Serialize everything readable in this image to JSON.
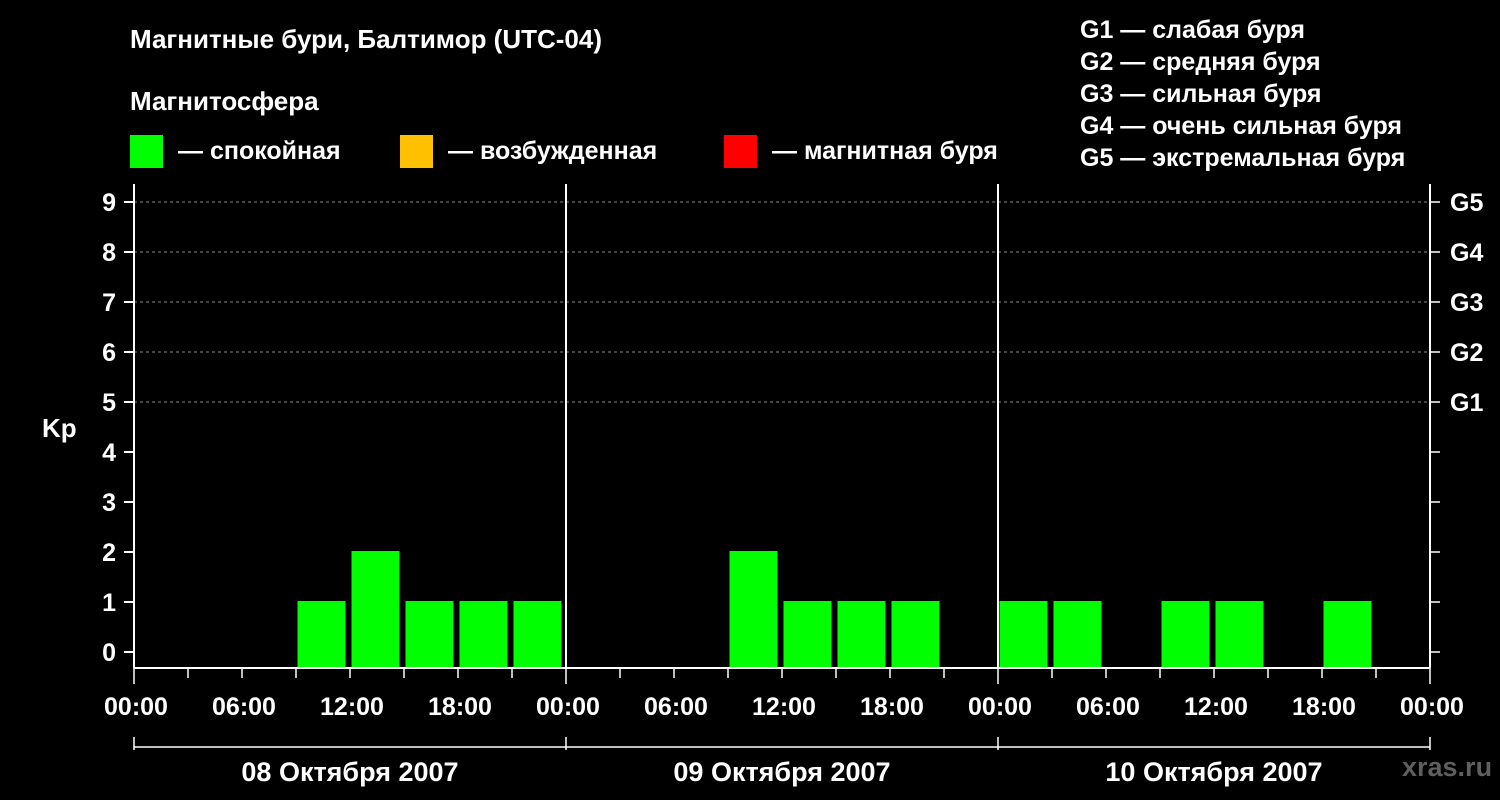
{
  "header": {
    "title": "Магнитные бури, Балтимор (UTC-04)",
    "subtitle": "Магнитосфера"
  },
  "legend": [
    {
      "label": "— спокойная",
      "color": "#00ff00"
    },
    {
      "label": "— возбужденная",
      "color": "#ffc000"
    },
    {
      "label": "— магнитная буря",
      "color": "#ff0000"
    }
  ],
  "storm_scale": [
    "G1 — слабая буря",
    "G2 — средняя буря",
    "G3 — сильная буря",
    "G4 — очень сильная буря",
    "G5 — экстремальная буря"
  ],
  "watermark": "xras.ru",
  "chart_data": {
    "type": "bar",
    "ylabel": "Kp",
    "ylim": [
      0,
      9
    ],
    "yticks": [
      "0",
      "1",
      "2",
      "3",
      "4",
      "5",
      "6",
      "7",
      "8",
      "9"
    ],
    "right_ticks": [
      {
        "kp": 5,
        "label": "G1"
      },
      {
        "kp": 6,
        "label": "G2"
      },
      {
        "kp": 7,
        "label": "G3"
      },
      {
        "kp": 8,
        "label": "G4"
      },
      {
        "kp": 9,
        "label": "G5"
      }
    ],
    "x_tick_labels": [
      "00:00",
      "06:00",
      "12:00",
      "18:00",
      "00:00",
      "06:00",
      "12:00",
      "18:00",
      "00:00",
      "06:00",
      "12:00",
      "18:00",
      "00:00"
    ],
    "days": [
      "08 Октября 2007",
      "09 Октября 2007",
      "10 Октября 2007"
    ],
    "interval_hours": 3,
    "values": [
      0,
      0,
      0,
      1,
      2,
      1,
      1,
      1,
      0,
      0,
      0,
      2,
      1,
      1,
      1,
      0,
      1,
      1,
      0,
      1,
      1,
      0,
      1,
      0
    ],
    "colors": {
      "quiet": "#00ff00",
      "active": "#ffc000",
      "storm": "#ff0000"
    },
    "grid": "dashed at G levels (Kp 5–9)"
  }
}
